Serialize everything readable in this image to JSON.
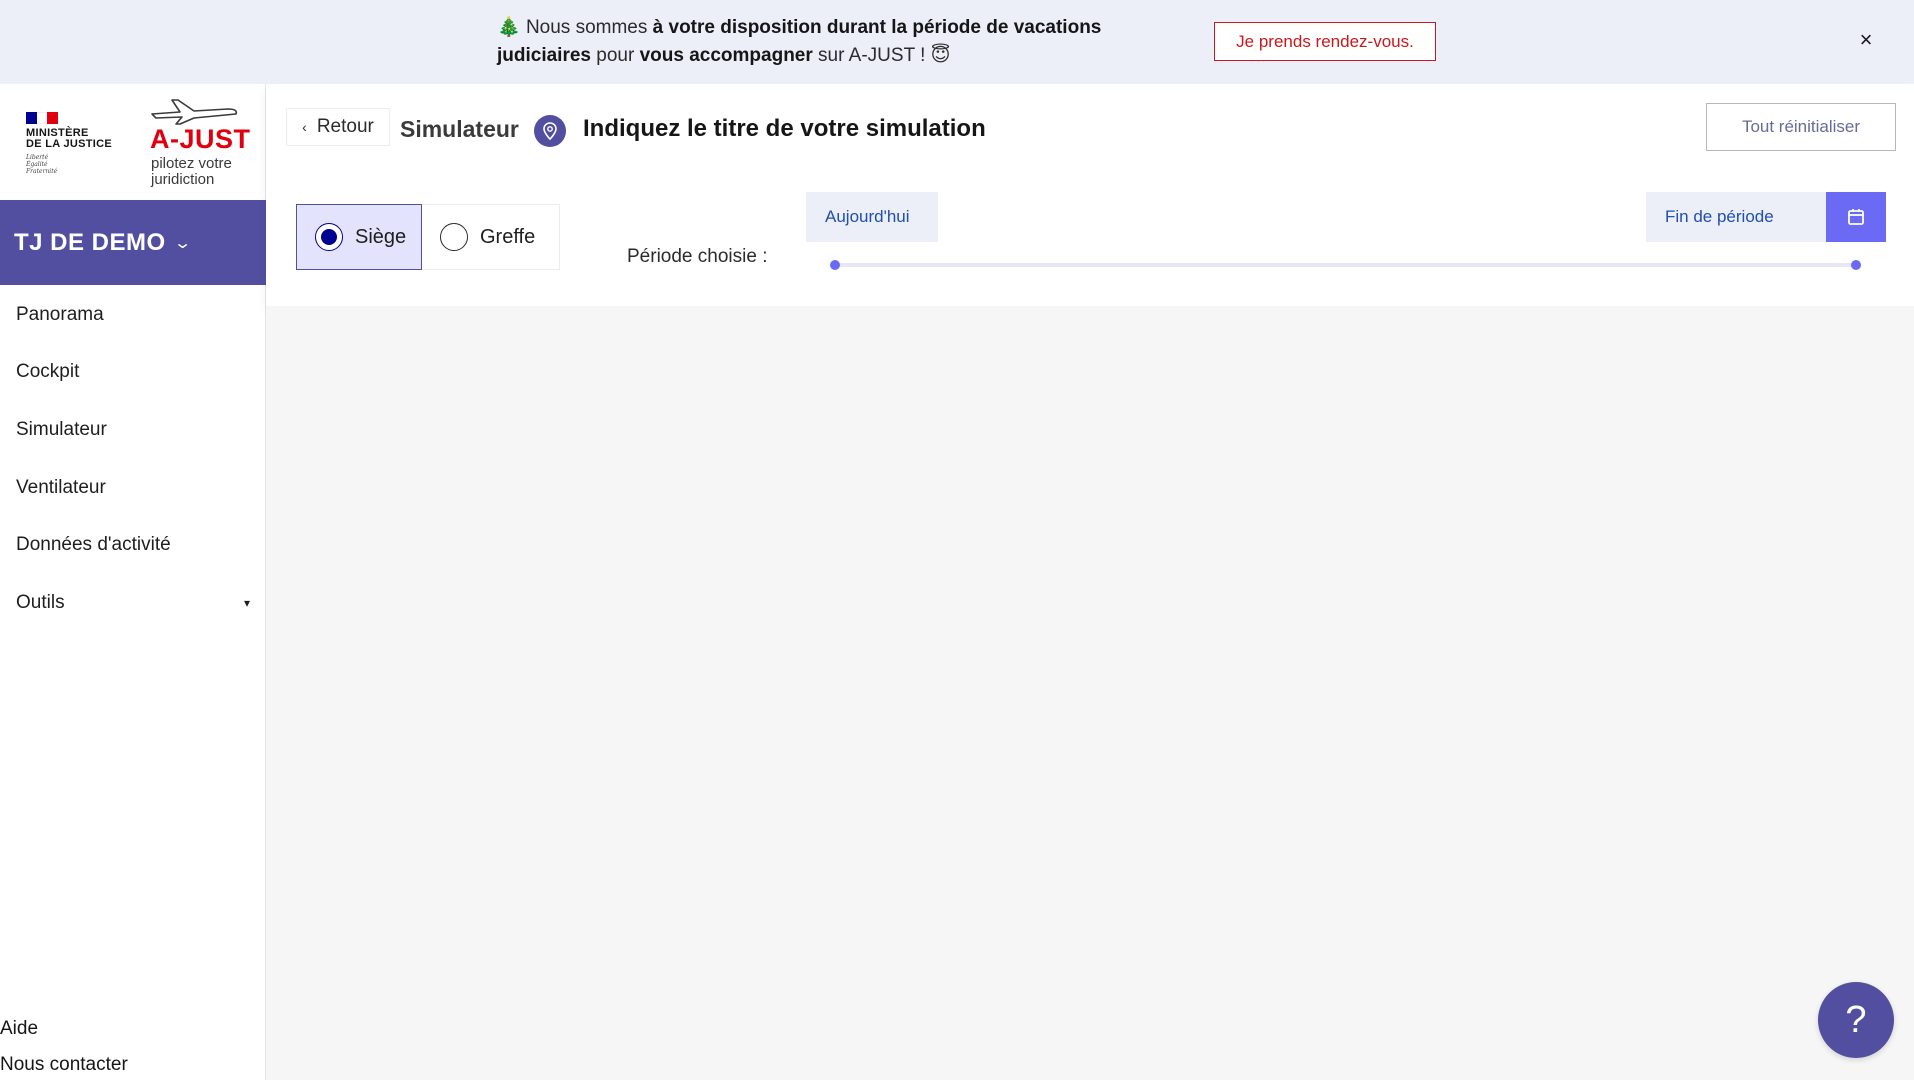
{
  "banner": {
    "part1": "Nous sommes ",
    "bold1": "à votre disposition durant la période de vacations judiciaires",
    "part2": " pour ",
    "bold2": "vous accompagner",
    "part3": " sur A-JUST !",
    "cta_label": "Je prends rendez-vous.",
    "close_label": "×",
    "tree_emoji": "🎄",
    "face_emoji": "😇"
  },
  "logo": {
    "ministere_line1": "MINISTÈRE",
    "ministere_line2": "DE LA JUSTICE",
    "devise_line1": "Liberté",
    "devise_line2": "Égalité",
    "devise_line3": "Fraternité",
    "brand": "A-JUST",
    "tagline_line1": "pilotez votre",
    "tagline_line2": "juridiction",
    "flag_colors": [
      "#000091",
      "#ffffff",
      "#e1000f"
    ]
  },
  "sidebar": {
    "jurisdiction": "TJ DE DEMO",
    "items": [
      {
        "label": "Panorama"
      },
      {
        "label": "Cockpit"
      },
      {
        "label": "Simulateur"
      },
      {
        "label": "Ventilateur"
      },
      {
        "label": "Données d'activité"
      },
      {
        "label": "Outils",
        "has_submenu": true
      }
    ],
    "footer": {
      "help": "Aide",
      "contact": "Nous contacter"
    }
  },
  "header": {
    "back_label": "Retour",
    "section_title": "Simulateur",
    "simulation_title": "Indiquez le titre de votre simulation",
    "reset_label": "Tout réinitialiser"
  },
  "filters": {
    "options": [
      {
        "label": "Siège",
        "selected": true
      },
      {
        "label": "Greffe",
        "selected": false
      }
    ],
    "period_label": "Période choisie :",
    "start_label": "Aujourd'hui",
    "end_label": "Fin de période"
  },
  "help_button": {
    "label": "?"
  },
  "colors": {
    "primary": "#524fa0",
    "accent": "#6a6af4",
    "alert_red": "#c9191e",
    "banner_bg": "#eceef8",
    "content_bg": "#f6f6f6"
  }
}
